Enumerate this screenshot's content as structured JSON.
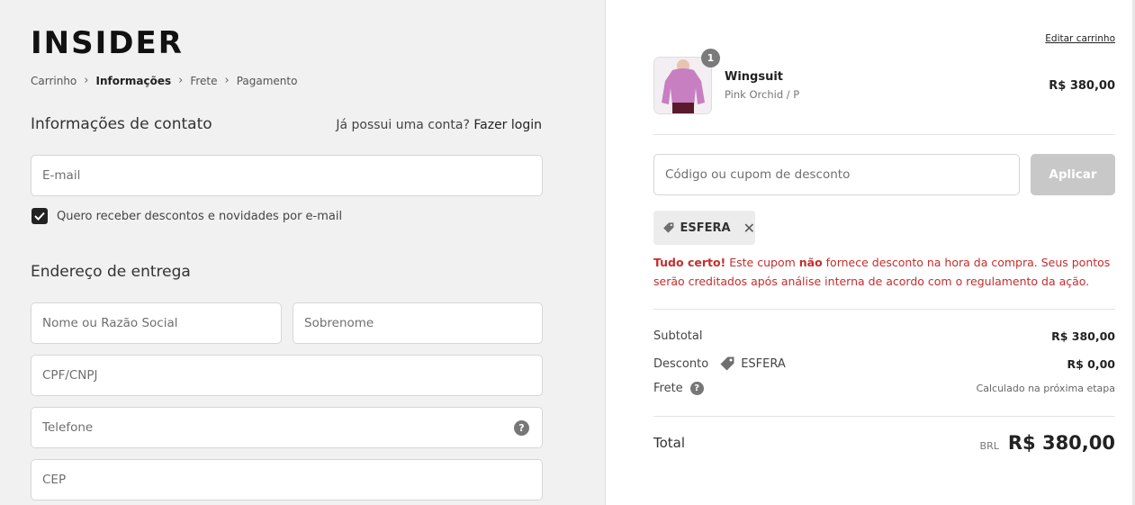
{
  "brand": {
    "logo": "INSIDER"
  },
  "breadcrumb": [
    {
      "label": "Carrinho",
      "active": false
    },
    {
      "label": "Informações",
      "active": true
    },
    {
      "label": "Frete",
      "active": false
    },
    {
      "label": "Pagamento",
      "active": false
    }
  ],
  "contact": {
    "title": "Informações de contato",
    "login_prompt": "Já possui uma conta?",
    "login_link": "Fazer login",
    "email_placeholder": "E-mail",
    "newsletter_label": "Quero receber descontos e novidades por e-mail",
    "newsletter_checked": true
  },
  "shipping": {
    "title": "Endereço de entrega",
    "name_placeholder": "Nome ou Razão Social",
    "surname_placeholder": "Sobrenome",
    "cpf_placeholder": "CPF/CNPJ",
    "phone_placeholder": "Telefone",
    "cep_placeholder": "CEP"
  },
  "cart": {
    "edit_label": "Editar carrinho",
    "item": {
      "name": "Wingsuit",
      "variant": "Pink Orchid / P",
      "price": "R$ 380,00",
      "quantity": "1",
      "image_color": "#c77fc2"
    },
    "coupon": {
      "placeholder": "Código ou cupom de desconto",
      "apply_label": "Aplicar",
      "applied_code": "ESFERA",
      "msg_strong1": "Tudo certo!",
      "msg_part1": " Este cupom ",
      "msg_strong2": "não",
      "msg_part2": " fornece desconto na hora da compra. Seus pontos serão creditados após análise interna de acordo com o regulamento da ação."
    },
    "summary": {
      "subtotal_label": "Subtotal",
      "subtotal_value": "R$ 380,00",
      "discount_label": "Desconto",
      "discount_code": "ESFERA",
      "discount_value": "R$ 0,00",
      "shipping_label": "Frete",
      "shipping_value": "Calculado na próxima etapa",
      "total_label": "Total",
      "currency": "BRL",
      "total_value": "R$ 380,00"
    }
  },
  "colors": {
    "error": "#c62d2d",
    "left_bg": "#f1f1f1",
    "button_disabled": "#c8c8c8"
  }
}
